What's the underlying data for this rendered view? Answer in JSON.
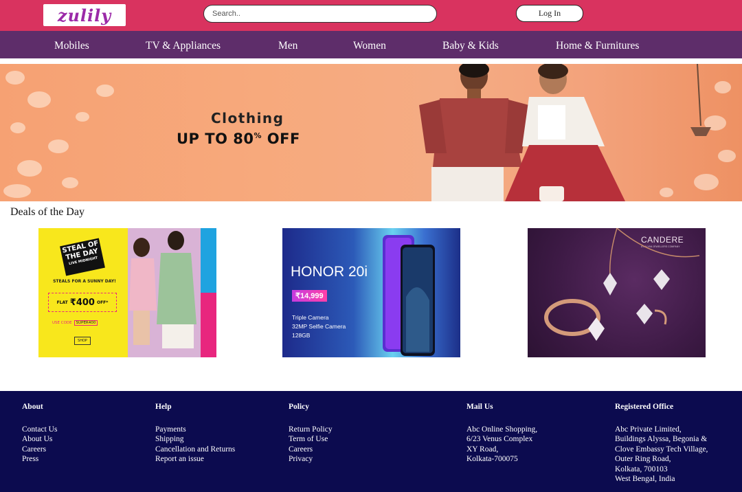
{
  "header": {
    "logo_text": "zulily",
    "search_placeholder": "Search..",
    "login_label": "Log In"
  },
  "nav": {
    "items": [
      "Mobiles",
      "TV & Appliances",
      "Men",
      "Women",
      "Baby & Kids",
      "Home & Furnitures"
    ]
  },
  "banner": {
    "title": "Clothing",
    "offer_main": "UP TO 80",
    "offer_pct": "%",
    "offer_end": " OFF"
  },
  "deals": {
    "title": "Deals of the Day",
    "cards": [
      {
        "name": "steal-of-the-day",
        "badge_line1": "STEAL OF",
        "badge_line2": "THE DAY",
        "badge_line3": "LIVE MIDNIGHT",
        "subtitle": "STEALS FOR A SUNNY DAY!",
        "offer_prefix": "FLAT",
        "offer_amount": "₹400",
        "offer_suffix": "OFF*",
        "code_label": "USE CODE",
        "code": "SUPER400",
        "cta": "SHOP"
      },
      {
        "name": "honor-20i",
        "title": "HONOR 20i",
        "price": "₹14,999",
        "features": [
          "Triple Camera",
          "32MP Selfie Camera",
          "128GB"
        ]
      },
      {
        "name": "candere",
        "brand": "CANDERE",
        "brand_sub": "A KALYAN JEWELLERS COMPANY"
      }
    ]
  },
  "footer": {
    "about": {
      "heading": "About",
      "links": [
        "Contact Us",
        "About Us",
        "Careers",
        "Press"
      ]
    },
    "help": {
      "heading": "Help",
      "links": [
        "Payments",
        "Shipping",
        "Cancellation and Returns",
        "Report an issue"
      ]
    },
    "policy": {
      "heading": "Policy",
      "links": [
        "Return Policy",
        "Term of Use",
        "Careers",
        "Privacy"
      ]
    },
    "mail": {
      "heading": "Mail Us",
      "lines": [
        "Abc Online Shopping,",
        "6/23 Venus Complex",
        "XY Road,",
        "Kolkata-700075"
      ]
    },
    "office": {
      "heading": "Registered Office",
      "lines": [
        "Abc Private Limited,",
        "Buildings Alyssa, Begonia &",
        "Clove Embassy Tech Village,",
        "Outer Ring Road,",
        "Kolkata, 700103",
        "West Bengal, India"
      ]
    }
  },
  "colors": {
    "topbar": "#d9335f",
    "navbar": "#5e2d6a",
    "footer": "#0c0b4f",
    "logo_text": "#9b2aa8"
  }
}
